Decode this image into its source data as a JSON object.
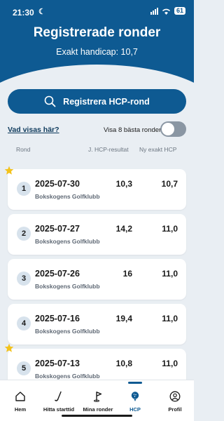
{
  "status_bar": {
    "time": "21:30",
    "battery": "61"
  },
  "header": {
    "title": "Registrerade ronder",
    "handicap_label": "Exakt handicap: 10,7"
  },
  "register_button": {
    "label": "Registrera HCP-rond"
  },
  "info_link": {
    "label": "Vad visas här?"
  },
  "best_toggle": {
    "label": "Visa 8 bästa ronder",
    "on": false
  },
  "columns": {
    "round": "Rond",
    "result": "J. HCP-resultat",
    "hcp": "Ny exakt HCP"
  },
  "rounds": [
    {
      "num": "1",
      "date": "2025-07-30",
      "club": "Bokskogens Golfklubb",
      "result": "10,3",
      "hcp": "10,7",
      "starred": true
    },
    {
      "num": "2",
      "date": "2025-07-27",
      "club": "Bokskogens Golfklubb",
      "result": "14,2",
      "hcp": "11,0",
      "starred": false
    },
    {
      "num": "3",
      "date": "2025-07-26",
      "club": "Bokskogens Golfklubb",
      "result": "16",
      "hcp": "11,0",
      "starred": false
    },
    {
      "num": "4",
      "date": "2025-07-16",
      "club": "Bokskogens Golfklubb",
      "result": "19,4",
      "hcp": "11,0",
      "starred": false
    },
    {
      "num": "5",
      "date": "2025-07-13",
      "club": "Bokskogens Golfklubb",
      "result": "10,8",
      "hcp": "11,0",
      "starred": true
    }
  ],
  "nav": {
    "home": "Hem",
    "tee": "Hitta starttid",
    "rounds": "Mina ronder",
    "hcp": "HCP",
    "profile": "Profil"
  },
  "colors": {
    "brand": "#0e5a92",
    "star": "#f3c21b"
  }
}
